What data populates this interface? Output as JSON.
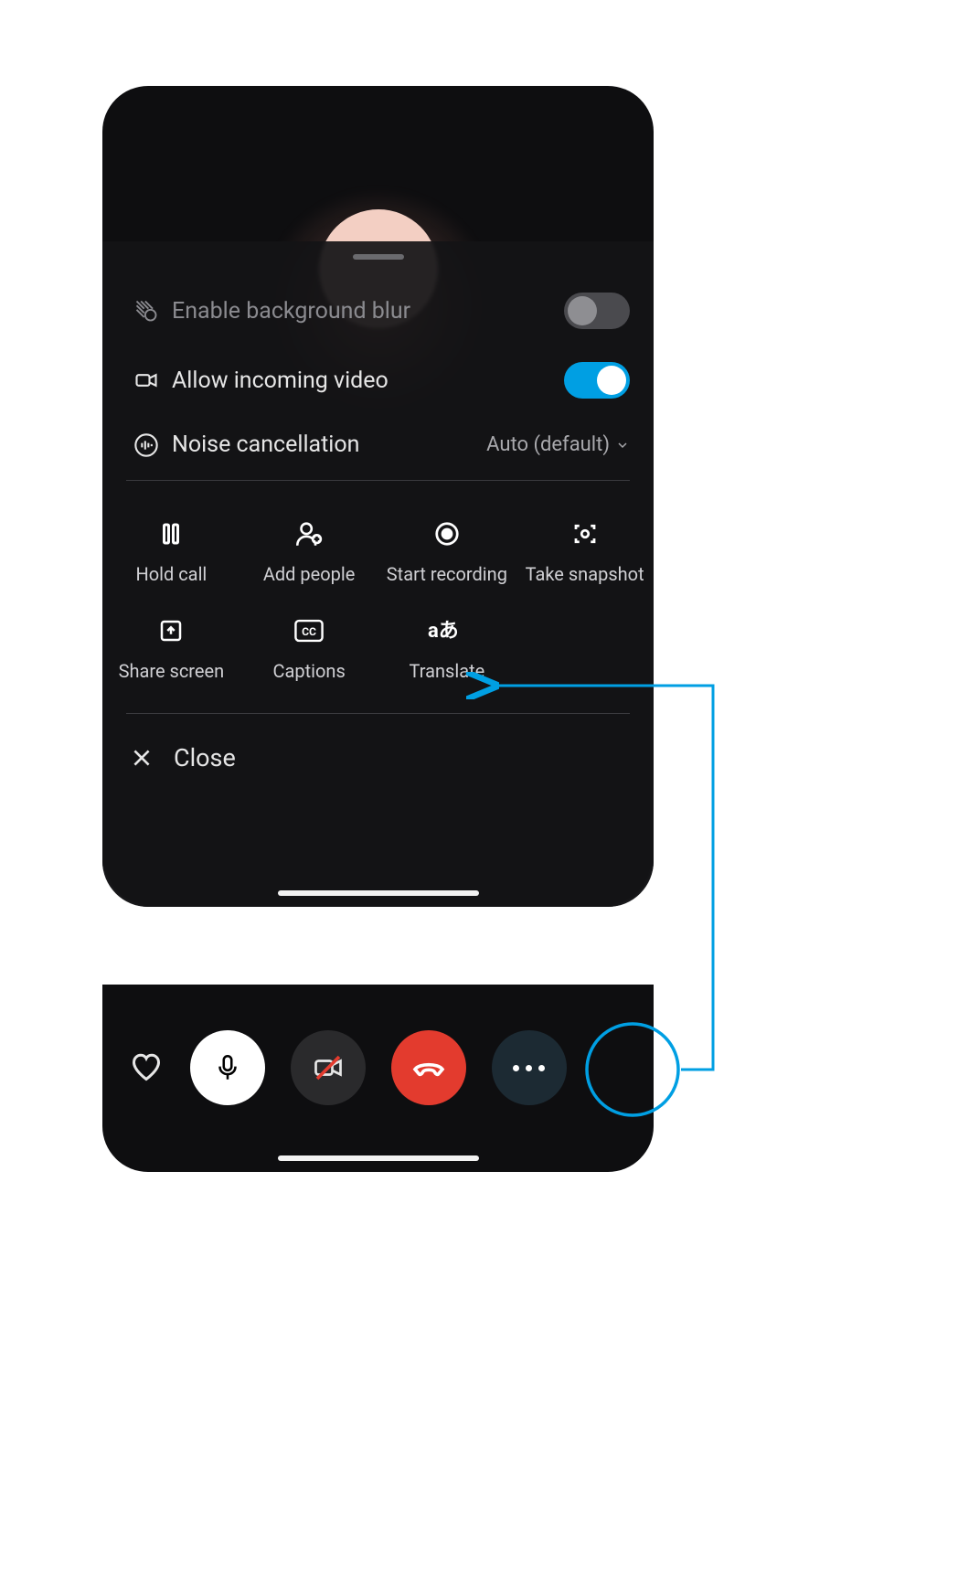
{
  "sheet": {
    "settings": {
      "blur": {
        "label": "Enable background blur",
        "enabled": false,
        "disabled_row": true
      },
      "incoming_video": {
        "label": "Allow incoming video",
        "enabled": true
      },
      "noise": {
        "label": "Noise cancellation",
        "value": "Auto (default)"
      }
    },
    "actions": [
      {
        "id": "hold",
        "label": "Hold call"
      },
      {
        "id": "add",
        "label": "Add people"
      },
      {
        "id": "record",
        "label": "Start recording"
      },
      {
        "id": "snapshot",
        "label": "Take snapshot"
      },
      {
        "id": "share",
        "label": "Share screen"
      },
      {
        "id": "captions",
        "label": "Captions"
      },
      {
        "id": "translate",
        "label": "Translate"
      }
    ],
    "close_label": "Close"
  },
  "callbar": {
    "mic": "Mute",
    "camera": "Camera off",
    "hangup": "Hang up",
    "more": "More"
  },
  "colors": {
    "accent_blue": "#009fe3",
    "highlight_stroke": "#009fe3",
    "hangup_red": "#e33b2e"
  }
}
